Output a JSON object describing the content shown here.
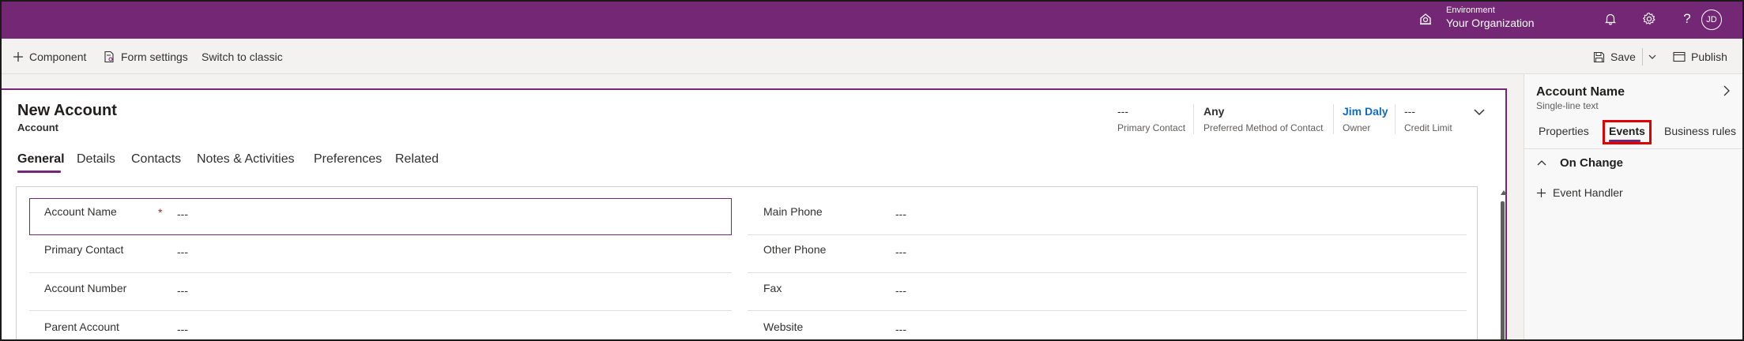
{
  "topbar": {
    "environment_label": "Environment",
    "environment_value": "Your Organization",
    "user_initials": "JD",
    "bg_color": "#742774"
  },
  "commandbar": {
    "component": "Component",
    "form_settings": "Form settings",
    "switch_classic": "Switch to classic",
    "save": "Save",
    "publish": "Publish"
  },
  "form": {
    "title": "New Account",
    "entity": "Account",
    "header_fields": [
      {
        "value": "---",
        "label": "Primary Contact"
      },
      {
        "value": "Any",
        "label": "Preferred Method of Contact"
      },
      {
        "value": "Jim Daly",
        "label": "Owner"
      },
      {
        "value": "---",
        "label": "Credit Limit"
      }
    ],
    "tabs": [
      "General",
      "Details",
      "Contacts",
      "Notes & Activities",
      "Preferences",
      "Related"
    ],
    "active_tab": "General",
    "left_fields": [
      {
        "label": "Account Name",
        "value": "---",
        "required": "*"
      },
      {
        "label": "Primary Contact",
        "value": "---"
      },
      {
        "label": "Account Number",
        "value": "---"
      },
      {
        "label": "Parent Account",
        "value": "---"
      }
    ],
    "right_fields": [
      {
        "label": "Main Phone",
        "value": "---"
      },
      {
        "label": "Other Phone",
        "value": "---"
      },
      {
        "label": "Fax",
        "value": "---"
      },
      {
        "label": "Website",
        "value": "---"
      }
    ]
  },
  "pane": {
    "title": "Account Name",
    "subtitle": "Single-line text",
    "tabs": [
      "Properties",
      "Events",
      "Business rules"
    ],
    "active_tab": "Events",
    "section": "On Change",
    "event_handler": "Event Handler",
    "highlight_color": "#e00000"
  },
  "icons": [
    "environment-icon",
    "bell-icon",
    "gear-icon",
    "help-icon",
    "plus-icon",
    "form-settings-icon",
    "save-icon",
    "chevron-down-icon",
    "publish-icon",
    "chevron-right-icon",
    "chevron-up-icon"
  ]
}
